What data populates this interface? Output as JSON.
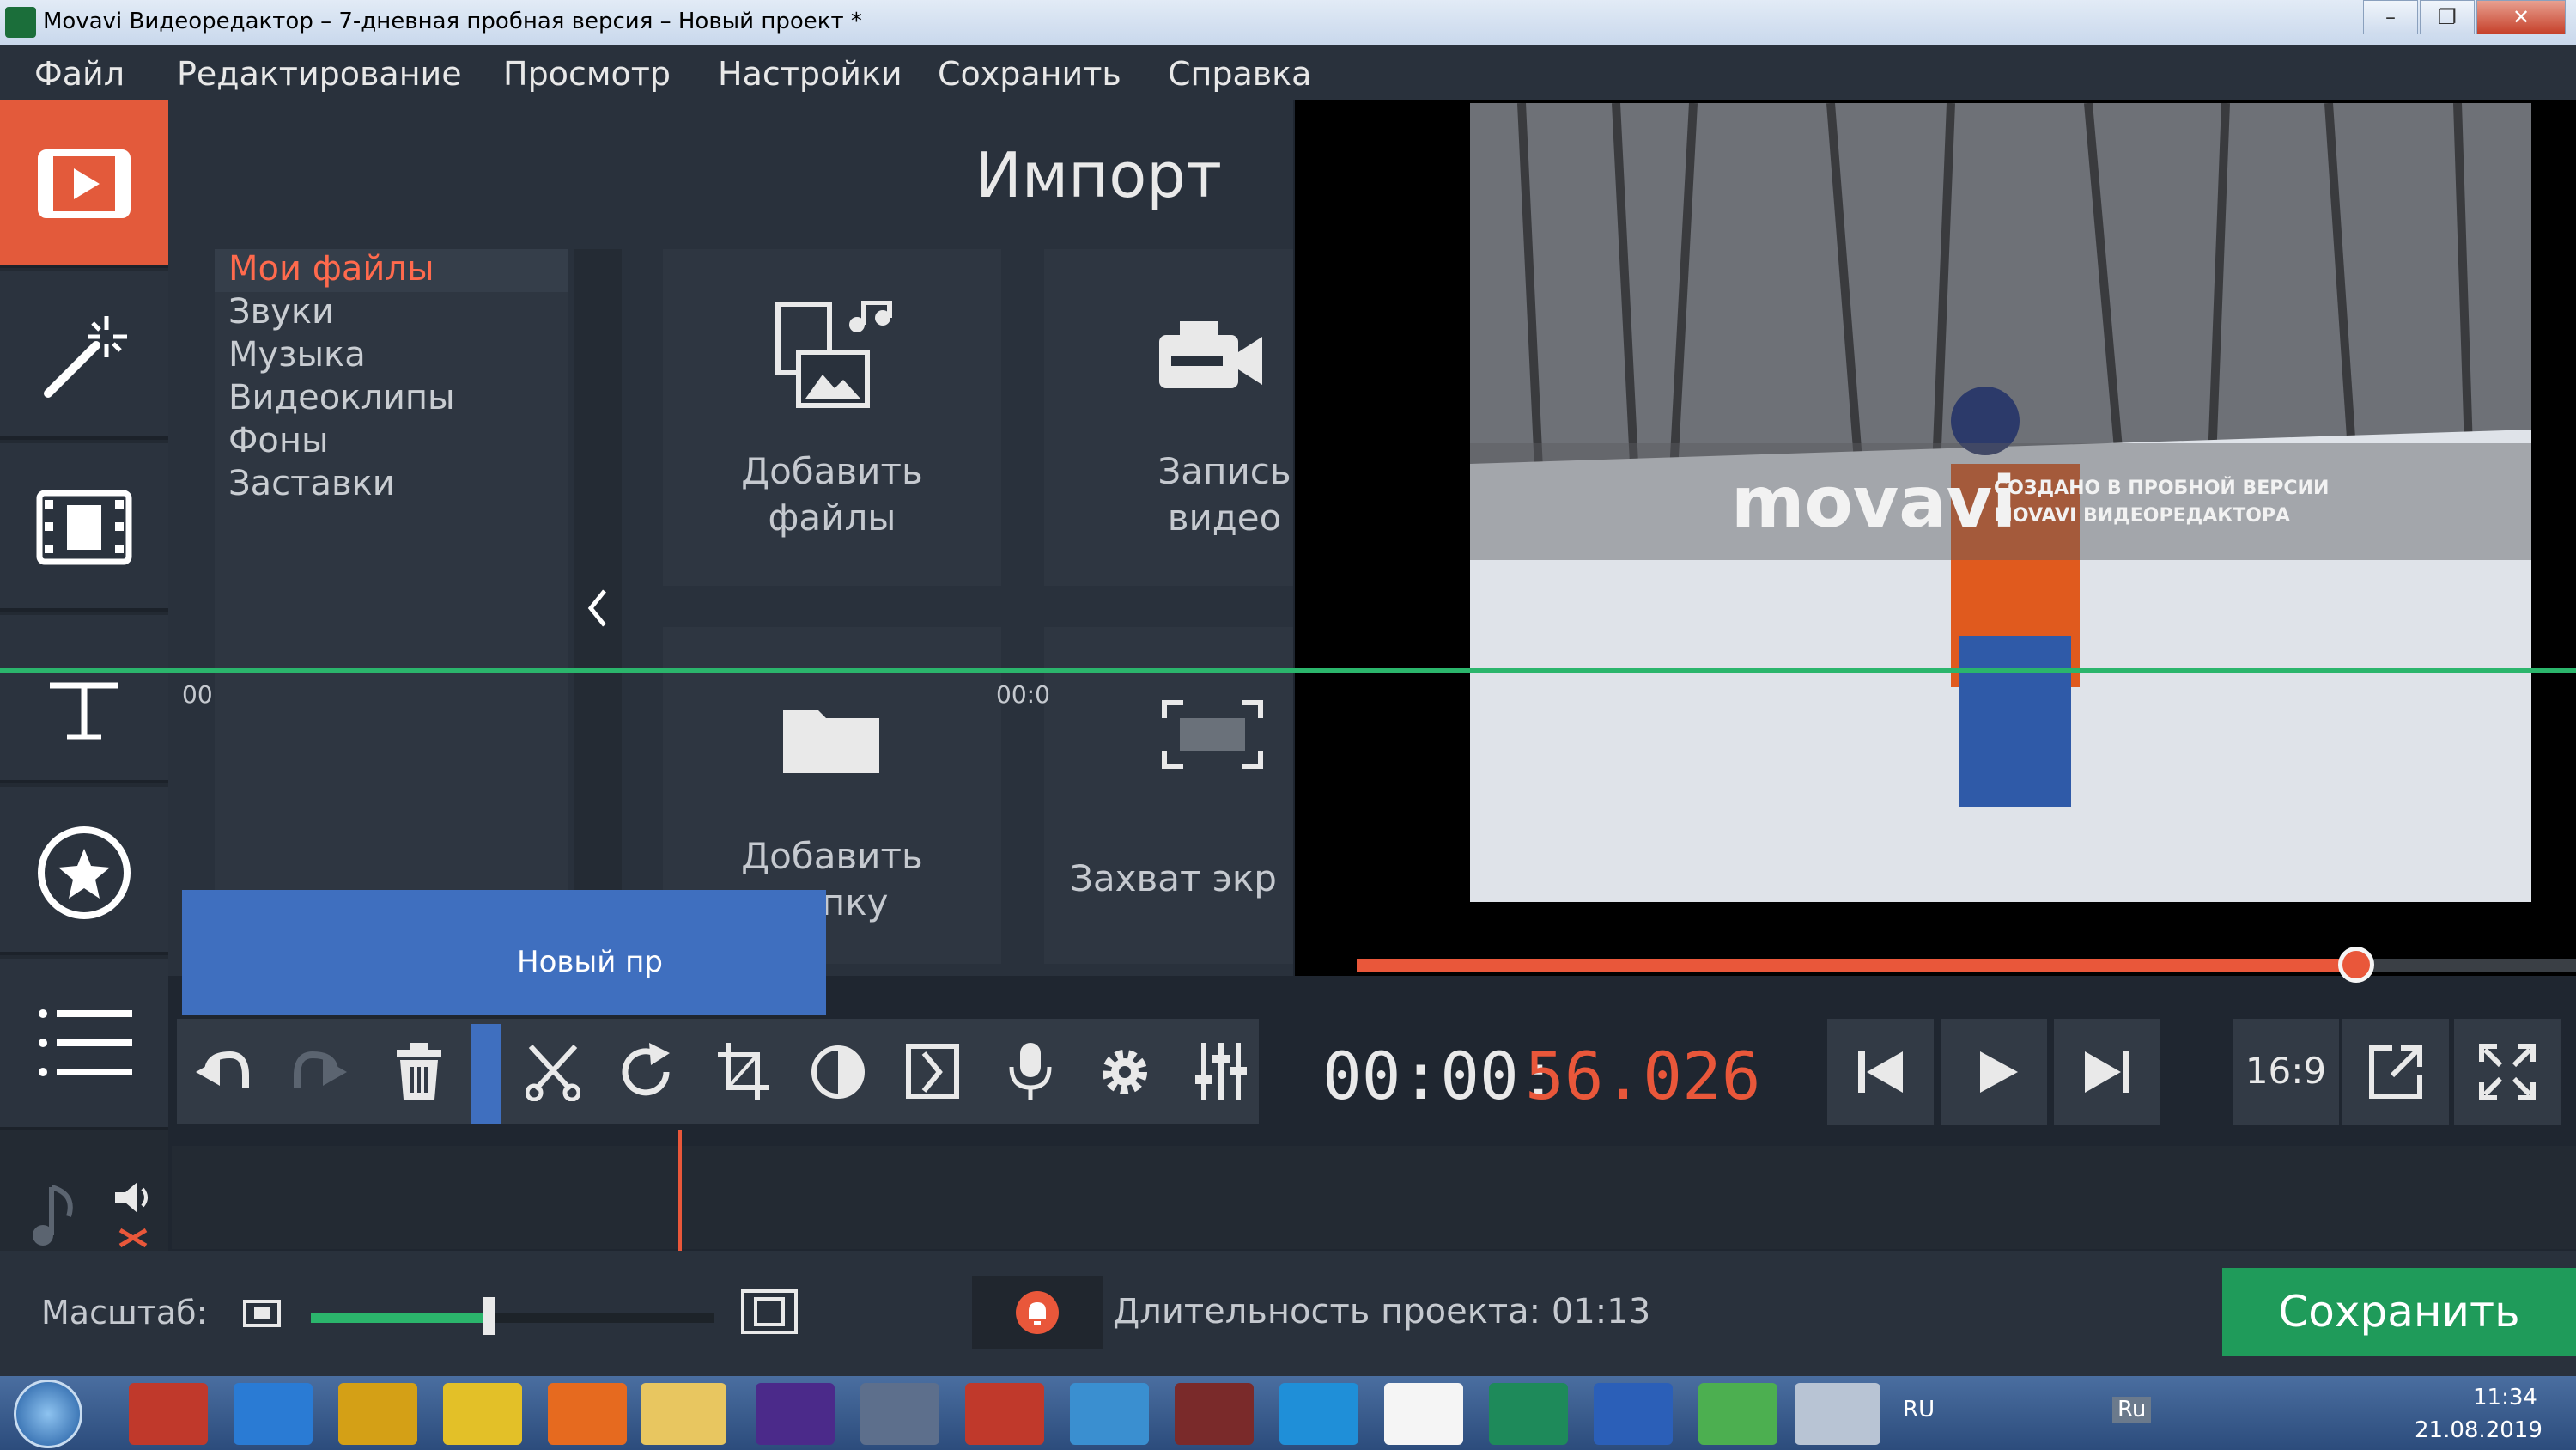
{
  "window": {
    "title": "Movavi Видеоредактор – 7-дневная пробная версия – Новый проект *",
    "minimize": "–",
    "maximize": "❐",
    "close": "✕"
  },
  "menu": [
    "Файл",
    "Редактирование",
    "Просмотр",
    "Настройки",
    "Сохранить",
    "Справка"
  ],
  "import": {
    "title": "Импорт",
    "categories": [
      "Мои файлы",
      "Звуки",
      "Музыка",
      "Видеоклипы",
      "Фоны",
      "Заставки"
    ],
    "tiles": {
      "add_files": "Добавить файлы",
      "record_video": "Запись видео",
      "add_folder": "Добавить папку",
      "screen_capture": "Захват экр"
    }
  },
  "preview": {
    "watermark_logo": "movavi",
    "watermark_line1": "СОЗДАНО В ПРОБНОЙ ВЕРСИИ",
    "watermark_line2": "MOVAVI ВИДЕОРЕДАКТОРА",
    "progress": 0.82
  },
  "playback": {
    "timecode_main": "00:00:",
    "timecode_frac": "56.026",
    "aspect": "16:9"
  },
  "timeline": {
    "ruler_left": "00",
    "ruler_mid": "00:0",
    "clip_title": "Новый пр"
  },
  "bottom": {
    "zoom_label": "Масштаб:",
    "zoom_level": 0.44,
    "duration_label": "Длительность проекта:",
    "duration_value": "01:13",
    "save_label": "Сохранить"
  },
  "taskbar": {
    "lang": "RU",
    "lang2": "Ru",
    "time": "11:34",
    "date": "21.08.2019"
  },
  "colors": {
    "accent": "#e9573a",
    "save_green": "#1f9b5a",
    "panel": "#29313c"
  }
}
